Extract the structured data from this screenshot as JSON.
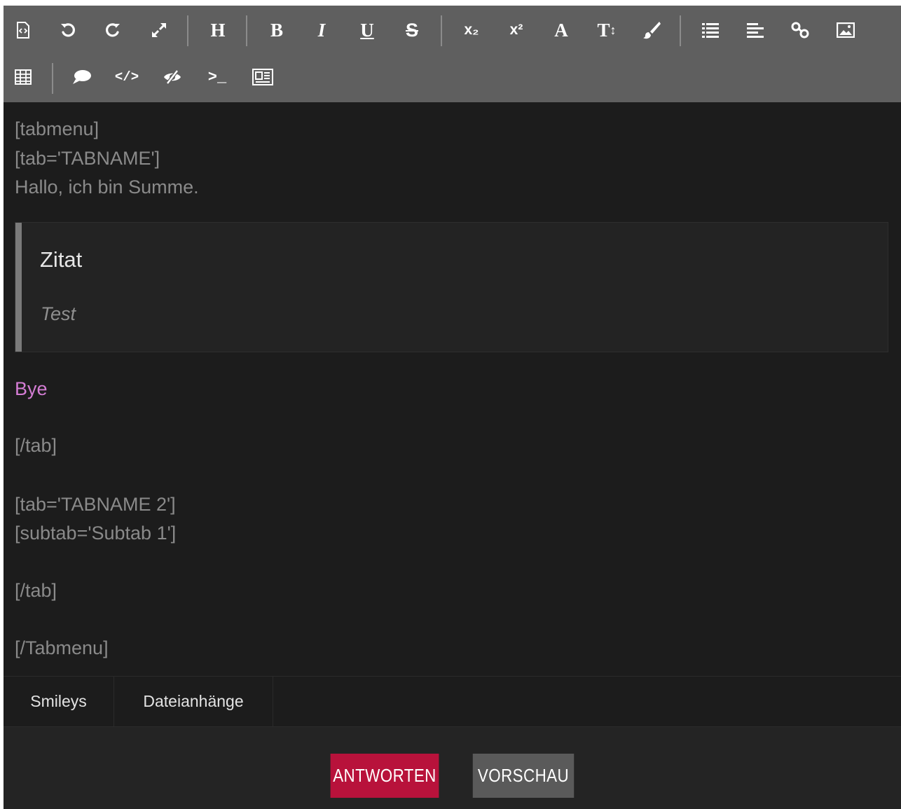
{
  "toolbar": {
    "buttons": [
      {
        "name": "source-code-icon",
        "label": ""
      },
      {
        "name": "undo-icon",
        "label": ""
      },
      {
        "name": "redo-icon",
        "label": ""
      },
      {
        "name": "fullscreen-icon",
        "label": ""
      },
      {
        "name": "heading-icon",
        "label": "H"
      },
      {
        "name": "bold-icon",
        "label": "B"
      },
      {
        "name": "italic-icon",
        "label": "I"
      },
      {
        "name": "underline-icon",
        "label": "U"
      },
      {
        "name": "strikethrough-icon",
        "label": "S"
      },
      {
        "name": "subscript-icon",
        "label": ""
      },
      {
        "name": "superscript-icon",
        "label": ""
      },
      {
        "name": "font-icon",
        "label": "A"
      },
      {
        "name": "font-size-icon",
        "label": "T"
      },
      {
        "name": "color-brush-icon",
        "label": ""
      },
      {
        "name": "list-icon",
        "label": ""
      },
      {
        "name": "align-icon",
        "label": ""
      },
      {
        "name": "link-icon",
        "label": ""
      },
      {
        "name": "image-icon",
        "label": ""
      },
      {
        "name": "table-icon",
        "label": ""
      },
      {
        "name": "quote-bubble-icon",
        "label": ""
      },
      {
        "name": "code-icon",
        "label": ""
      },
      {
        "name": "spoiler-icon",
        "label": ""
      },
      {
        "name": "terminal-icon",
        "label": ""
      },
      {
        "name": "media-icon",
        "label": ""
      }
    ],
    "subscript_label": "x₂",
    "superscript_label": "x²"
  },
  "content": {
    "line_1": "[tabmenu]",
    "line_2": "[tab='TABNAME']",
    "line_3": "Hallo, ich bin Summe.",
    "quote_title": "Zitat",
    "quote_body": "Test",
    "bye": "Bye",
    "line_close_tab_1": "[/tab]",
    "line_tab_2": "[tab='TABNAME 2']",
    "line_subtab": "[subtab='Subtab 1']",
    "line_close_tab_2": "[/tab]",
    "line_close_menu": "[/Tabmenu]",
    "bye_color": "#d47dd4"
  },
  "tabs": {
    "smileys": "Smileys",
    "attachments": "Dateianhänge"
  },
  "actions": {
    "reply": "ANTWORTEN",
    "preview": "VORSCHAU",
    "reply_color": "#b8123b"
  }
}
